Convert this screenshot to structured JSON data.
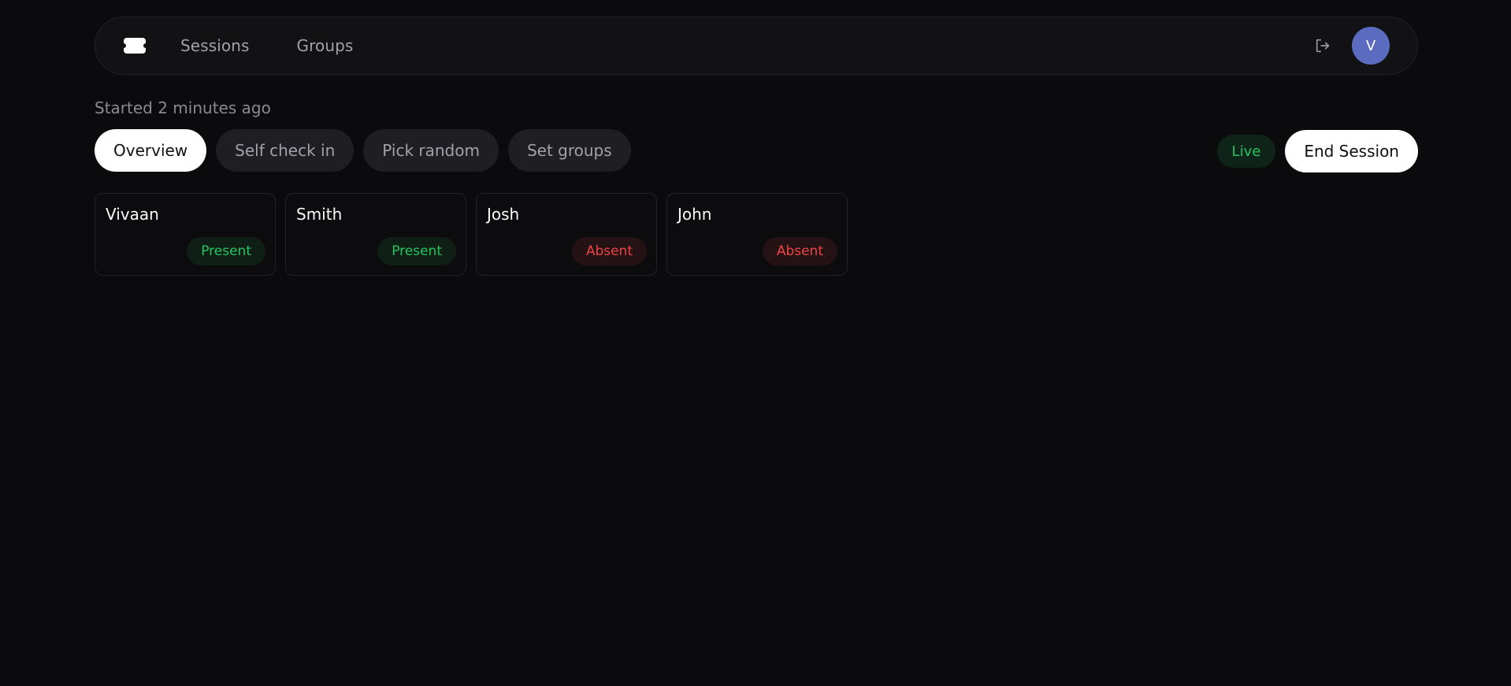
{
  "nav": {
    "links": [
      "Sessions",
      "Groups"
    ],
    "avatar_initial": "V"
  },
  "session": {
    "started_text": "Started 2 minutes ago",
    "status_badge": "Live",
    "end_button": "End Session"
  },
  "tabs": [
    "Overview",
    "Self check in",
    "Pick random",
    "Set groups"
  ],
  "students": [
    {
      "name": "Vivaan",
      "status": "Present"
    },
    {
      "name": "Smith",
      "status": "Present"
    },
    {
      "name": "Josh",
      "status": "Absent"
    },
    {
      "name": "John",
      "status": "Absent"
    }
  ],
  "colors": {
    "present": "#22c55e",
    "absent": "#ef4444",
    "avatar": "#5b6bc0"
  },
  "icons": {
    "logo": "ticket-icon",
    "logout": "logout-icon"
  }
}
